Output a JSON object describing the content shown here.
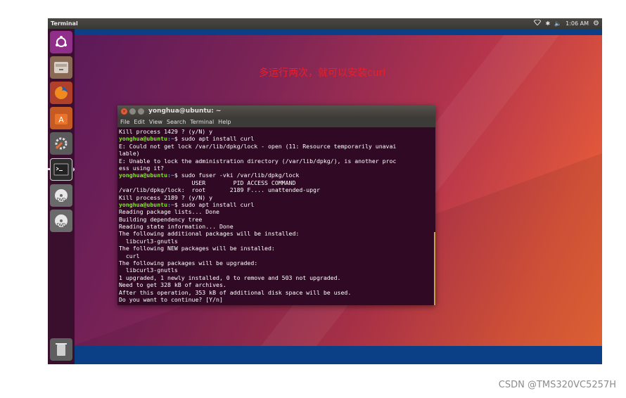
{
  "topbar": {
    "app_title": "Terminal",
    "clock": "1:06 AM",
    "icons": [
      "wifi-icon",
      "bluetooth-icon",
      "volume-icon",
      "gear-icon"
    ]
  },
  "launcher": {
    "items": [
      {
        "name": "ubuntu-dash-icon"
      },
      {
        "name": "files-icon"
      },
      {
        "name": "firefox-icon"
      },
      {
        "name": "software-center-icon"
      },
      {
        "name": "system-settings-icon"
      },
      {
        "name": "terminal-icon"
      },
      {
        "name": "dvd-icon"
      },
      {
        "name": "dvd-icon"
      },
      {
        "name": "trash-icon"
      }
    ]
  },
  "annotation": "多运行两次，就可以安装curl",
  "terminal": {
    "title": "yonghua@ubuntu: ~",
    "menu": [
      "File",
      "Edit",
      "View",
      "Search",
      "Terminal",
      "Help"
    ],
    "prompt_user": "yonghua@ubuntu",
    "prompt_path": ":~",
    "lines": [
      {
        "type": "out",
        "text": "Kill process 1429 ? (y/N) y"
      },
      {
        "type": "cmd",
        "text": "$ sudo apt install curl"
      },
      {
        "type": "out",
        "text": "E: Could not get lock /var/lib/dpkg/lock - open (11: Resource temporarily unavai"
      },
      {
        "type": "out",
        "text": "lable)"
      },
      {
        "type": "out",
        "text": "E: Unable to lock the administration directory (/var/lib/dpkg/), is another proc"
      },
      {
        "type": "out",
        "text": "ess using it?"
      },
      {
        "type": "cmd",
        "text": "$ sudo fuser -vki /var/lib/dpkg/lock"
      },
      {
        "type": "out",
        "text": "                     USER        PID ACCESS COMMAND"
      },
      {
        "type": "out",
        "text": "/var/lib/dpkg/lock:  root       2189 F.... unattended-upgr"
      },
      {
        "type": "out",
        "text": "Kill process 2189 ? (y/N) y"
      },
      {
        "type": "cmd",
        "text": "$ sudo apt install curl"
      },
      {
        "type": "out",
        "text": "Reading package lists... Done"
      },
      {
        "type": "out",
        "text": "Building dependency tree"
      },
      {
        "type": "out",
        "text": "Reading state information... Done"
      },
      {
        "type": "out",
        "text": "The following additional packages will be installed:"
      },
      {
        "type": "out",
        "text": "  libcurl3-gnutls"
      },
      {
        "type": "out",
        "text": "The following NEW packages will be installed:"
      },
      {
        "type": "out",
        "text": "  curl"
      },
      {
        "type": "out",
        "text": "The following packages will be upgraded:"
      },
      {
        "type": "out",
        "text": "  libcurl3-gnutls"
      },
      {
        "type": "out",
        "text": "1 upgraded, 1 newly installed, 0 to remove and 503 not upgraded."
      },
      {
        "type": "out",
        "text": "Need to get 328 kB of archives."
      },
      {
        "type": "out",
        "text": "After this operation, 353 kB of additional disk space will be used."
      },
      {
        "type": "out",
        "text": "Do you want to continue? [Y/n]"
      }
    ]
  },
  "watermark": "CSDN @TMS320VC5257H",
  "colors": {
    "terminal_bg": "#300a24",
    "prompt_user": "#8ae234",
    "prompt_path": "#729fcf",
    "annotation": "#e8202a"
  }
}
